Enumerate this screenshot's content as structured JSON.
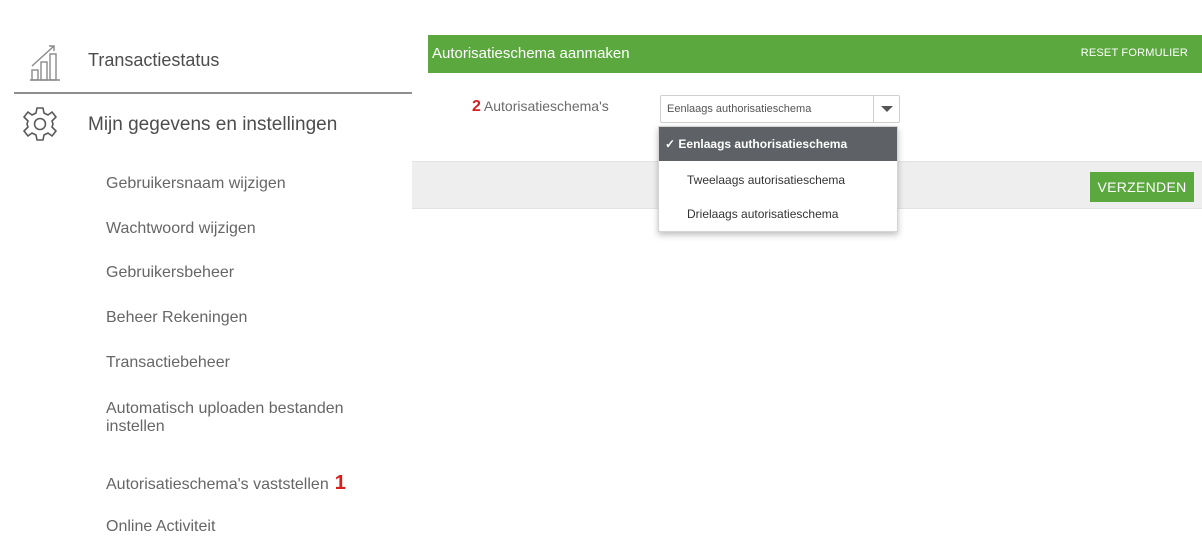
{
  "sidebar": {
    "transaction_status": {
      "label": "Transactiestatus",
      "icon": "chart-bars-icon"
    },
    "settings": {
      "label": "Mijn gegevens en instellingen",
      "icon": "gear-icon"
    },
    "items": [
      {
        "label": "Gebruikersnaam wijzigen"
      },
      {
        "label": "Wachtwoord wijzigen"
      },
      {
        "label": "Gebruikersbeheer"
      },
      {
        "label": "Beheer Rekeningen"
      },
      {
        "label": "Transactiebeheer"
      },
      {
        "label": "Automatisch uploaden bestanden instellen"
      },
      {
        "label": "Autorisatieschema's vaststellen",
        "marker": "1"
      },
      {
        "label": "Online Activiteit"
      }
    ]
  },
  "panel": {
    "title": "Autorisatieschema aanmaken",
    "reset_label": "RESET FORMULIER",
    "field": {
      "marker": "2",
      "label": "Autorisatieschema's",
      "selected_value": "Eenlaags authorisatieschema"
    },
    "submit_label": "VERZENDEN"
  },
  "dropdown": {
    "options": [
      {
        "label": "✓ Eenlaags authorisatieschema",
        "selected": true
      },
      {
        "label": "Tweelaags autorisatieschema",
        "selected": false
      },
      {
        "label": "Drielaags autorisatieschema",
        "selected": false
      }
    ]
  },
  "colors": {
    "accent_green": "#5ba83f",
    "marker_red": "#d81e1e",
    "selected_option_bg": "#5e6266"
  }
}
